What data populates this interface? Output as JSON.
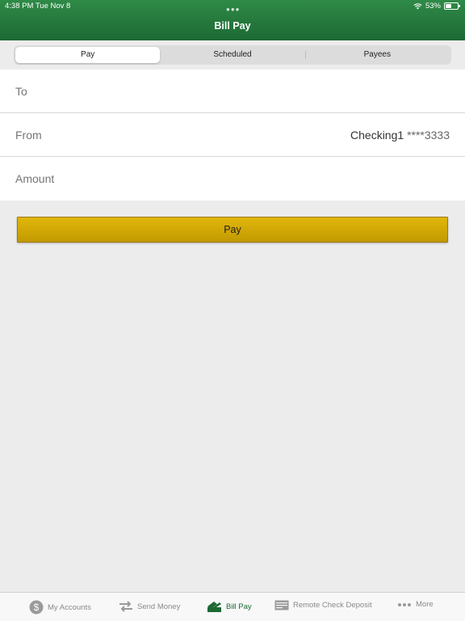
{
  "status": {
    "time": "4:38 PM   Tue Nov 8",
    "battery": "53%",
    "battery_level": 0.53
  },
  "header": {
    "title": "Bill Pay",
    "more_icon": "ellipsis-icon"
  },
  "segments": [
    {
      "label": "Pay",
      "active": true
    },
    {
      "label": "Scheduled",
      "active": false
    },
    {
      "label": "Payees",
      "active": false
    }
  ],
  "form": {
    "to_label": "To",
    "from_label": "From",
    "from_account": "Checking1",
    "from_masked": "****3333",
    "amount_label": "Amount"
  },
  "pay_button": {
    "label": "Pay"
  },
  "tabbar": {
    "items": [
      {
        "label": "My Accounts",
        "icon": "dollar-circle-icon"
      },
      {
        "label": "Send Money",
        "icon": "transfer-arrows-icon"
      },
      {
        "label": "Bill Pay",
        "icon": "bill-pay-icon",
        "active": true
      },
      {
        "label": "Remote Check Deposit",
        "icon": "check-icon"
      },
      {
        "label": "More",
        "icon": "ellipsis-icon"
      }
    ]
  },
  "colors": {
    "header": "#1d6934",
    "accent_button": "#c9a100",
    "active_tab": "#1d6934"
  }
}
